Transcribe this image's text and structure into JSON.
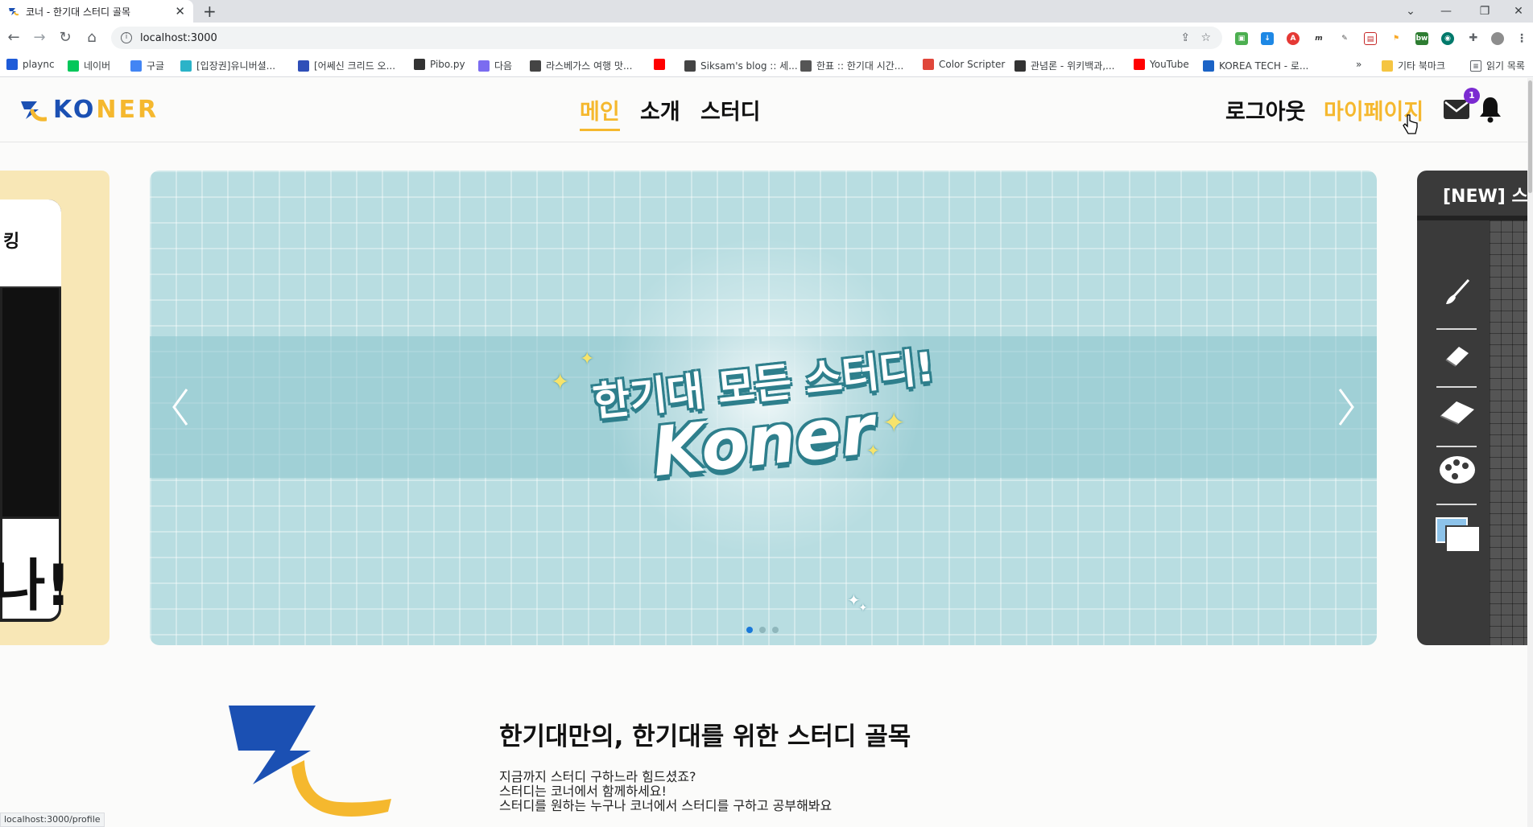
{
  "browser": {
    "tab_title": "코너 - 한기대 스터디 골목",
    "tab_close": "✕",
    "new_tab": "+",
    "url": "localhost:3000",
    "window_controls": [
      "⌄",
      "—",
      "❐",
      "✕"
    ],
    "bookmarks": [
      {
        "label": "plaync",
        "icon": "nc-icon",
        "color": "#1e5bd8"
      },
      {
        "label": "네이버",
        "icon": "naver-icon",
        "color": "#03c75a"
      },
      {
        "label": "구글",
        "icon": "google-icon",
        "color": "#4285f4"
      },
      {
        "label": "[입장권]유니버셜...",
        "icon": "k-icon",
        "color": "#2bb3c8"
      },
      {
        "label": "[어쎄신 크리드 오...",
        "icon": "cube-icon",
        "color": "#2f4fb8"
      },
      {
        "label": "Pibo.py",
        "icon": "pibo-icon",
        "color": "#333333"
      },
      {
        "label": "다음",
        "icon": "daum-icon",
        "color": "#7b6cf0"
      },
      {
        "label": "라스베가스 여행 맛...",
        "icon": "dots-icon",
        "color": "#444444"
      },
      {
        "label": "",
        "icon": "youtube-icon",
        "color": "#ff0000"
      },
      {
        "label": "Siksam's blog :: 세...",
        "icon": "dots-icon",
        "color": "#444444"
      },
      {
        "label": "한표 :: 한기대 시간...",
        "icon": "calendar-icon",
        "color": "#555555"
      },
      {
        "label": "Color Scripter",
        "icon": "color-scripter-icon",
        "color": "#e0463a"
      },
      {
        "label": "관념론 - 위키백과,...",
        "icon": "wikipedia-icon",
        "color": "#333333"
      },
      {
        "label": "YouTube",
        "icon": "youtube-icon",
        "color": "#ff0000"
      },
      {
        "label": "KOREA TECH - 로...",
        "icon": "check-icon",
        "color": "#1b63c6"
      }
    ],
    "bookmarks_more": "»",
    "other_bookmarks": "기타 북마크",
    "reading_list": "읽기 목록",
    "status_url": "localhost:3000/profile"
  },
  "header": {
    "logo_text_a": "KO",
    "logo_text_b": "NER",
    "nav": [
      "메인",
      "소개",
      "스터디"
    ],
    "logout": "로그아웃",
    "mypage": "마이페이지",
    "notification_count": "1"
  },
  "carousel": {
    "left_slide_text_top": "킹",
    "left_slide_text_big": "나!",
    "hero_line1": "한기대 모든 스터디!",
    "hero_line2": "Koner",
    "right_slide_title": "[NEW] 스",
    "dots": 3,
    "active_dot": 0
  },
  "intro": {
    "title": "한기대만의, 한기대를 위한 스터디 골목",
    "lines": [
      "지금까지 스터디 구하느라 힘드셨죠?",
      "스터디는 코너에서 함께하세요!",
      "스터디를 원하는 누구나 코너에서 스터디를 구하고 공부해봐요"
    ]
  },
  "colors": {
    "brand_blue": "#1b50b3",
    "brand_yellow": "#f5b82e",
    "banner_bg": "#b8dde1",
    "badge": "#7b2bd1"
  }
}
